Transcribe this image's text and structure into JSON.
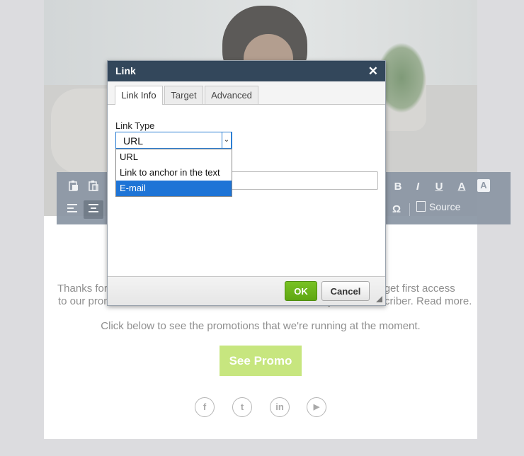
{
  "dialog": {
    "title": "Link",
    "close_glyph": "✕",
    "tabs": [
      {
        "label": "Link Info",
        "active": true
      },
      {
        "label": "Target",
        "active": false
      },
      {
        "label": "Advanced",
        "active": false
      }
    ],
    "link_type_label": "Link Type",
    "link_type_value": "URL",
    "link_type_options": [
      "URL",
      "Link to anchor in the text",
      "E-mail"
    ],
    "highlighted_option": "E-mail",
    "ok_label": "OK",
    "cancel_label": "Cancel"
  },
  "toolbar": {
    "source_label": "Source",
    "icons": [
      "paste-icon",
      "paste-text-icon",
      "align-left-icon",
      "align-center-icon",
      "bold-icon",
      "italic-icon",
      "underline-icon",
      "text-color-icon",
      "background-color-icon",
      "special-char-icon",
      "source-icon"
    ],
    "bold": "B",
    "italic": "I",
    "underline": "U",
    "text_color": "A",
    "bg_color": "A",
    "special_char": "Ω"
  },
  "email": {
    "para1_left": "Thanks for",
    "para1_right": "'ll get first access",
    "para2_left": "to our pron",
    "para2_mid": "y",
    "para2_right": "criber. Read more.",
    "para3": "Click below to see the promotions that we're running at the moment.",
    "promo_button": "See Promo",
    "social": [
      {
        "icon": "facebook-icon",
        "glyph": "f"
      },
      {
        "icon": "twitter-icon",
        "glyph": "t"
      },
      {
        "icon": "linkedin-icon",
        "glyph": "in"
      },
      {
        "icon": "youtube-icon",
        "glyph": "▶"
      }
    ]
  },
  "colors": {
    "dialog_header": "#33475b",
    "ok_green": "#6bb41a",
    "selection_blue": "#1e74d6",
    "promo_green": "#c7e67f",
    "toolbar": "#8d98a6"
  }
}
